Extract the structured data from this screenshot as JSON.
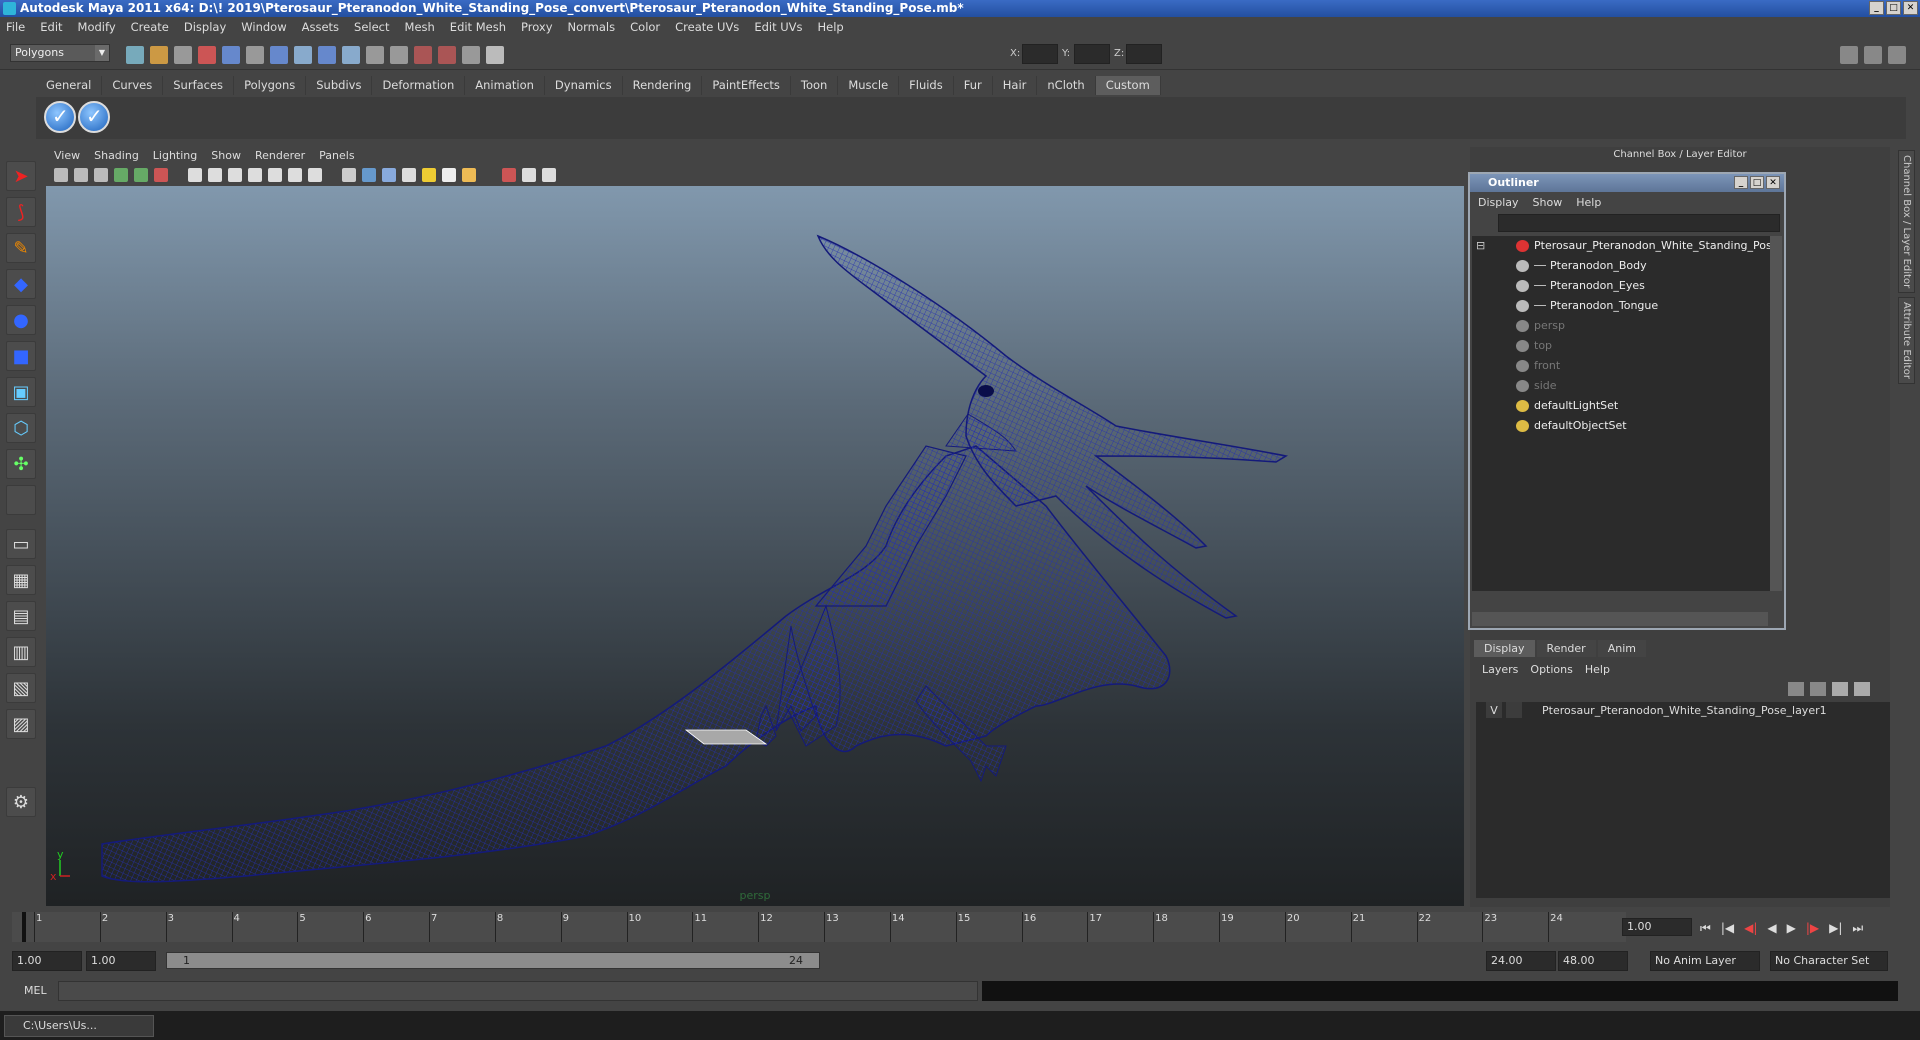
{
  "window": {
    "title": "Autodesk Maya 2011 x64: D:\\! 2019\\Pterosaur_Pteranodon_White_Standing_Pose_convert\\Pterosaur_Pteranodon_White_Standing_Pose.mb*"
  },
  "menubar": [
    "File",
    "Edit",
    "Modify",
    "Create",
    "Display",
    "Window",
    "Assets",
    "Select",
    "Mesh",
    "Edit Mesh",
    "Proxy",
    "Normals",
    "Color",
    "Create UVs",
    "Edit UVs",
    "Help"
  ],
  "status": {
    "mode": "Polygons",
    "coord_labels": [
      "X:",
      "Y:",
      "Z:"
    ]
  },
  "shelf": {
    "tabs": [
      "General",
      "Curves",
      "Surfaces",
      "Polygons",
      "Subdivs",
      "Deformation",
      "Animation",
      "Dynamics",
      "Rendering",
      "PaintEffects",
      "Toon",
      "Muscle",
      "Fluids",
      "Fur",
      "Hair",
      "nCloth",
      "Custom"
    ],
    "active_tab": "Custom"
  },
  "viewport": {
    "menu": [
      "View",
      "Shading",
      "Lighting",
      "Show",
      "Renderer",
      "Panels"
    ],
    "camera_label": "persp",
    "axis_y": "y",
    "axis_x": "x",
    "wire_color": "#1a1f8a"
  },
  "channel_box": {
    "title": "Channel Box / Layer Editor"
  },
  "side_tabs": [
    "Channel Box / Layer Editor",
    "Attribute Editor"
  ],
  "outliner": {
    "title": "Outliner",
    "menu": [
      "Display",
      "Show",
      "Help"
    ],
    "items": [
      {
        "label": "Pterosaur_Pteranodon_White_Standing_Pose",
        "indent": 0,
        "dim": false,
        "icon": "transform-icon"
      },
      {
        "label": "Pteranodon_Body",
        "indent": 1,
        "dim": false,
        "icon": "mesh-icon"
      },
      {
        "label": "Pteranodon_Eyes",
        "indent": 1,
        "dim": false,
        "icon": "mesh-icon"
      },
      {
        "label": "Pteranodon_Tongue",
        "indent": 1,
        "dim": false,
        "icon": "mesh-icon"
      },
      {
        "label": "persp",
        "indent": 0,
        "dim": true,
        "icon": "camera-icon"
      },
      {
        "label": "top",
        "indent": 0,
        "dim": true,
        "icon": "camera-icon"
      },
      {
        "label": "front",
        "indent": 0,
        "dim": true,
        "icon": "camera-icon"
      },
      {
        "label": "side",
        "indent": 0,
        "dim": true,
        "icon": "camera-icon"
      },
      {
        "label": "defaultLightSet",
        "indent": 0,
        "dim": false,
        "icon": "set-icon"
      },
      {
        "label": "defaultObjectSet",
        "indent": 0,
        "dim": false,
        "icon": "set-icon"
      }
    ]
  },
  "layer_editor": {
    "tabs": [
      "Display",
      "Render",
      "Anim"
    ],
    "active_tab": "Display",
    "menu": [
      "Layers",
      "Options",
      "Help"
    ],
    "layers": [
      {
        "visible": "V",
        "name": "Pterosaur_Pteranodon_White_Standing_Pose_layer1"
      }
    ]
  },
  "timeline": {
    "ticks": [
      1,
      2,
      3,
      4,
      5,
      6,
      7,
      8,
      9,
      10,
      11,
      12,
      13,
      14,
      15,
      16,
      17,
      18,
      19,
      20,
      21,
      22,
      23,
      24
    ],
    "current_frame": "1.00",
    "current_marker": "1"
  },
  "range": {
    "start": "1.00",
    "inner_start": "1.00",
    "bar_start": "1",
    "bar_end": "24",
    "end": "24.00",
    "anim_end": "48.00",
    "anim_layer": "No Anim Layer",
    "char_set": "No Character Set"
  },
  "cmdline": {
    "label": "MEL"
  },
  "taskbar": {
    "item": "C:\\Users\\Us..."
  }
}
